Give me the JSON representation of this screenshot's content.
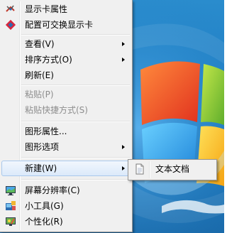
{
  "context_menu": {
    "items": [
      {
        "label": "显示卡属性",
        "icon": "graphics-card-icon"
      },
      {
        "label": "配置可交换显示卡",
        "icon": "switchable-graphics-icon"
      },
      {
        "label": "查看(V)",
        "submenu": true
      },
      {
        "label": "排序方式(O)",
        "submenu": true
      },
      {
        "label": "刷新(E)"
      },
      {
        "label": "粘贴(P)",
        "disabled": true
      },
      {
        "label": "粘贴快捷方式(S)",
        "disabled": true
      },
      {
        "label": "图形属性..."
      },
      {
        "label": "图形选项",
        "submenu": true
      },
      {
        "label": "新建(W)",
        "submenu": true,
        "highlighted": true
      },
      {
        "label": "屏幕分辨率(C)",
        "icon": "screen-resolution-icon"
      },
      {
        "label": "小工具(G)",
        "icon": "gadgets-icon"
      },
      {
        "label": "个性化(R)",
        "icon": "personalize-icon"
      }
    ]
  },
  "new_submenu": {
    "items": [
      {
        "label": "文本文档",
        "icon": "text-document-icon"
      }
    ]
  }
}
